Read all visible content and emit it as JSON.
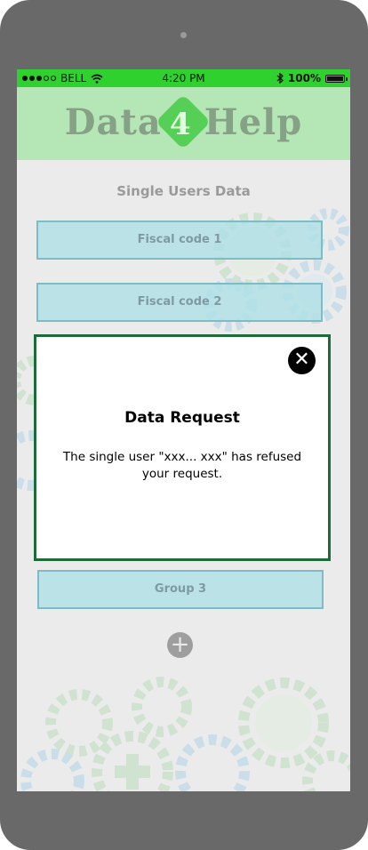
{
  "status_bar": {
    "carrier": "BELL",
    "time": "4:20 PM",
    "battery": "100%"
  },
  "header": {
    "logo_left": "Data",
    "logo_badge": "4",
    "logo_right": "Help"
  },
  "page": {
    "title": "Single Users Data"
  },
  "groups": [
    {
      "label": "Fiscal code 1"
    },
    {
      "label": "Fiscal code 2"
    },
    {
      "label": "Group 3"
    }
  ],
  "add_button": {
    "symbol": "+"
  },
  "modal": {
    "title": "Data Request",
    "message": "The single user \"xxx... xxx\" has refused your request.",
    "close_symbol": "✕"
  },
  "colors": {
    "status_bar": "#2fd12f",
    "header": "#b5e6b5",
    "modal_border": "#1e6b3a",
    "button_fill": "#aee0e6"
  }
}
